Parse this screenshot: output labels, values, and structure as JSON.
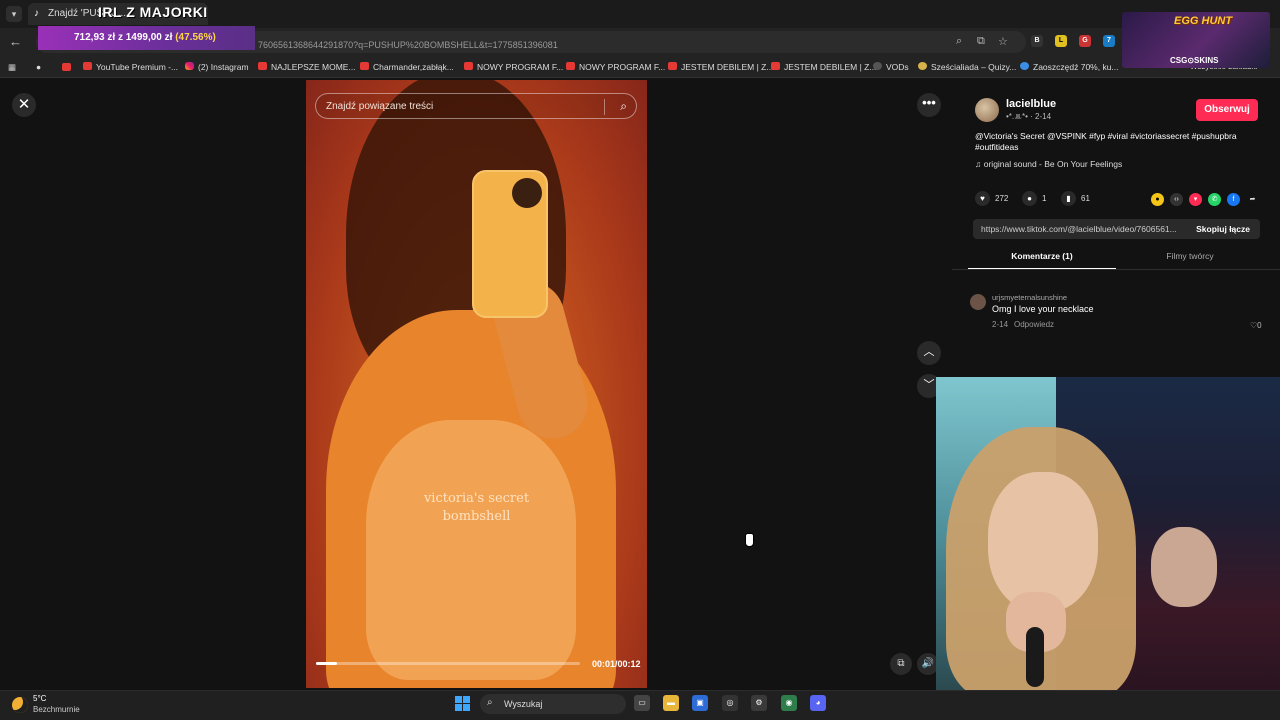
{
  "browser": {
    "tab_title": "Znajdź 'PUSHU...",
    "url": "7606561368644291870?q=PUSHUP%20BOMBSHELL&t=1775851396081",
    "bookmarks": [
      "YouTube Premium -...",
      "(2) Instagram",
      "NAJLEPSZE MOME...",
      "Charmander,zabłąk...",
      "NOWY PROGRAM F...",
      "NOWY PROGRAM F...",
      "JESTEM DEBILEM | Z...",
      "JESTEM DEBILEM | Z...",
      "VODs",
      "Sześcialiada – Quizy...",
      "Zaoszczędź 70%, ku..."
    ],
    "all_bookmarks": "Wszystkie zakładki"
  },
  "stream_overlay": {
    "title": "IRL Z MAJORKI",
    "donation_current": "712,93 zł",
    "donation_of": "z",
    "donation_goal": "1499,00 zł",
    "donation_percent": "(47.56%)",
    "donation_progress": 0.4756,
    "promo_title": "EGG HUNT",
    "promo_brand": "CSG⊙SKINS"
  },
  "video": {
    "search_placeholder": "Znajdź powiązane treści",
    "overlay_line1": "victoria's secret",
    "overlay_line2": "bombshell",
    "time": "00:01/00:12",
    "progress": 0.08
  },
  "post": {
    "username": "lacielblue",
    "submeta": "•*.ꔛ*• · 2-14",
    "follow_label": "Obserwuj",
    "caption": "@Victoria's Secret @VSPINK #fyp #viral #victoriassecret #pushupbra #outfitideas",
    "sound": "original sound - Be On Your Feelings",
    "likes": "272",
    "comments": "1",
    "saves": "61",
    "link": "https://www.tiktok.com/@lacielblue/video/7606561...",
    "copy_label": "Skopiuj łącze",
    "tab_comments": "Komentarze (1)",
    "tab_videos": "Filmy twórcy"
  },
  "comment": {
    "user": "urjsmyeternalsunshine",
    "text": "Omg I love your necklace",
    "date": "2-14",
    "reply": "Odpowiedz",
    "likes": "0"
  },
  "taskbar": {
    "temp": "5°C",
    "condition": "Bezchmurnie",
    "search_label": "Wyszukaj"
  },
  "colors": {
    "follow": "#fe2c55",
    "donation_bar": "#9a30b8",
    "windows_accent": "#3ea6ff"
  }
}
